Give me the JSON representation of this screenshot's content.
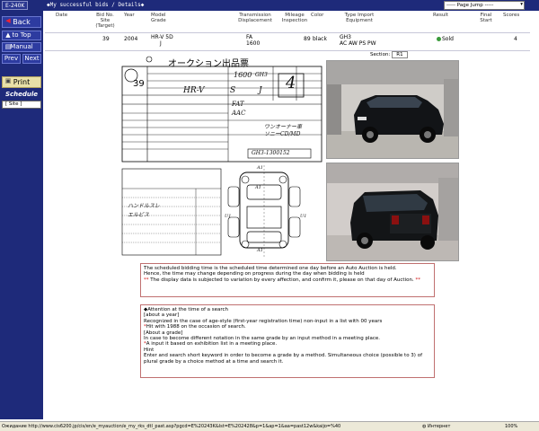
{
  "topbar": {
    "code": "E-240K",
    "crumb": "◆My successful bids / Details◆",
    "page_jump": "----- Page Jump -----"
  },
  "nav": {
    "back": "Back",
    "to_top": "to Top",
    "manual": "Manual",
    "prev": "Prev",
    "next": "Next",
    "print": "Print",
    "schedule": "Schedule",
    "site": "[ Site ]"
  },
  "table": {
    "headers": {
      "date": "Date",
      "bid_no": "Bid No.",
      "site": "Site",
      "target": "(Target)",
      "year": "Year",
      "model": "Model",
      "grade": "Grade",
      "transmission": "Transmission",
      "displacement": "Displacement",
      "mileage": "Mileage",
      "inspection": "Inspection",
      "color": "Color",
      "type": "Type",
      "import": "Import",
      "equipment": "Equipment",
      "result": "Result",
      "final": "Final",
      "start": "Start",
      "scores": "Scores"
    },
    "row": {
      "bid_no": "39",
      "year": "2004",
      "model": "HR-V 5D",
      "grade": "J",
      "transmission": "FA",
      "displacement": "1600",
      "mileage": "89",
      "color": "black",
      "type": "GH3",
      "equipment": "AC AW PS PW",
      "result": "Sold",
      "scores": "4"
    }
  },
  "section": {
    "label": "Section:",
    "value": "R1"
  },
  "sheet": {
    "title": "オークション出品票",
    "lot": "39",
    "hand_notes": [
      "1600",
      "GH3",
      "HR-V",
      "S",
      "J",
      "4",
      "FAT",
      "AAC",
      "ワンオーナー車",
      "ソニーCD/MD",
      "GH3-1300152",
      "ハンドルスレ",
      "エルビス",
      "A1",
      "A1",
      "U1",
      "U1",
      "A1"
    ]
  },
  "info1": {
    "line1": "The scheduled bidding time is the scheduled time determined one day before an Auto Auction is held.",
    "line2": "Hence, the time may change depending on progress during the day when bidding is held",
    "line3_mark": "**",
    "line3": "The display data is subjected to variation by every affection, and confirm it, please on that day of Auction.",
    "line3_end": "**"
  },
  "info2": {
    "title": "◆Attention at the time of a search",
    "sub1": "[about a year]",
    "p1": "Recognized in the case of age-style (first-year registration time) non-input in a list with 00 years",
    "p2_mark": "*",
    "p2": "Hit with 1988 on the occasion of search.",
    "sub2": "[About a grade]",
    "p3": "In case to become different notation in the same grade by an input method in a meeting place.",
    "p4_mark": "*",
    "p4": "A input it based on exhibition list in a meeting place.",
    "hint": "Hint",
    "p5": "Enter and search short keyword in order to become a grade by a method.  Simultaneous choice (possible to 3) of plural grade by a choice method at a time and search it."
  },
  "statusbar": {
    "url": "Ожидание http://www.cis6200.jp/cis/en/e_myauction/e_my_rks_dtl_past.asp?pgcd=E%20243K&lst=E%202428&p=1&ap=1&aa=past12w&kaijo=%40",
    "zone": "Интернет",
    "zoom": "100%"
  },
  "colors": {
    "navy": "#1e2a7a",
    "accent_red": "#d01010",
    "sold_green": "#3a9a3a"
  }
}
